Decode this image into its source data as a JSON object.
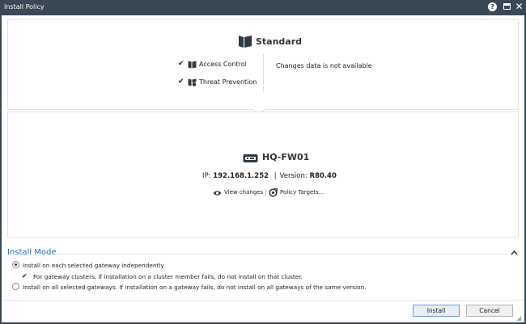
{
  "window": {
    "title": "Install Policy",
    "controls": {
      "help": "?",
      "close": "✕"
    }
  },
  "policy": {
    "name": "Standard",
    "blades": [
      {
        "label": "Access Control",
        "checked": true,
        "icon": "book-icon"
      },
      {
        "label": "Threat Prevention",
        "checked": true,
        "icon": "threat-prevention-icon"
      }
    ],
    "changes_status": "Changes data is not available"
  },
  "gateway": {
    "name": "HQ-FW01",
    "ip_label": "IP:",
    "ip": "192.168.1.252",
    "separator": "|",
    "version_label": "Version:",
    "version": "R80.40",
    "view_changes": "View changes",
    "policy_targets": "Policy Targets..."
  },
  "install_mode": {
    "title": "Install Mode",
    "options": [
      {
        "label": "Install on each selected gateway independently",
        "selected": true
      },
      {
        "label": "Install on all selected gateways. If installation on a gateway fails, do not install on all gateways of the same version.",
        "selected": false
      }
    ],
    "cluster_option": {
      "label": "For gateway clusters, if installation on a cluster member fails, do not install on that cluster.",
      "checked": true
    }
  },
  "buttons": {
    "install": "Install",
    "cancel": "Cancel"
  },
  "colors": {
    "titlebar": "#3a4754",
    "accent": "#1e6fb5",
    "icon": "#2f3a46"
  }
}
